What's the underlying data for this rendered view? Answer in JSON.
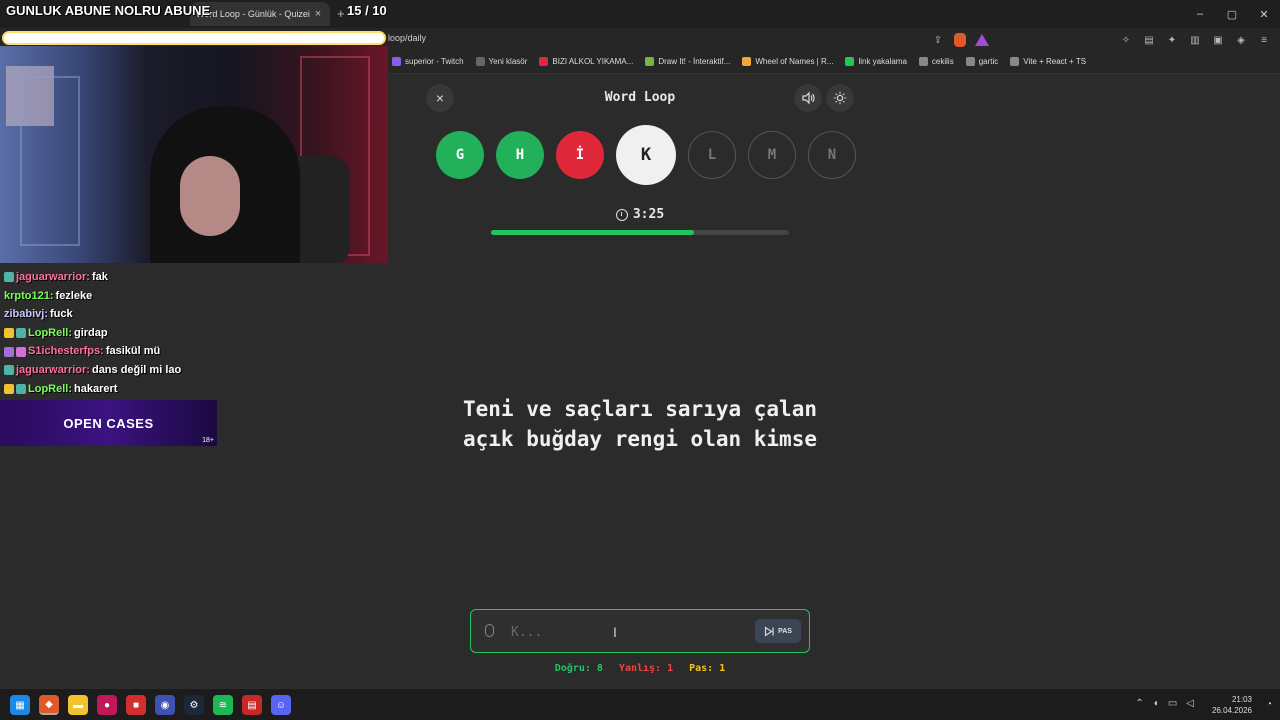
{
  "browser": {
    "tab_title": "Word Loop - Günlük - Quizei",
    "tab_close": "×",
    "new_tab": "+",
    "url": "loop/daily",
    "window_controls": [
      "–",
      "▢",
      "✕"
    ],
    "bookmarks": [
      {
        "label": "superior - Twitch",
        "color": "#8f5ae8"
      },
      {
        "label": "Yeni klasör",
        "color": "#666666"
      },
      {
        "label": "BIZI ALKOL YIKAMA...",
        "color": "#e0283b"
      },
      {
        "label": "Draw It! - İnteraktif...",
        "color": "#7cb342"
      },
      {
        "label": "Wheel of Names | R...",
        "color": "#f2a93b"
      },
      {
        "label": "link yakalama",
        "color": "#22c55e"
      },
      {
        "label": "cekilis",
        "color": "#888888"
      },
      {
        "label": "gartic",
        "color": "#888888"
      },
      {
        "label": "Vite + React + TS",
        "color": "#888888"
      }
    ]
  },
  "overlay": {
    "title": "GUNLUK ABUNE NOLRU ABUNE",
    "count": "15 / 10",
    "chat": [
      {
        "user": "jaguarwarrior:",
        "msg": "fak"
      },
      {
        "user": "krpto121:",
        "msg": "fezleke"
      },
      {
        "user": "zibabivj:",
        "msg": "fuck"
      },
      {
        "user": "LopRell:",
        "msg": "girdap"
      },
      {
        "user": "S1ichesterfps:",
        "msg": "fasikül mü"
      },
      {
        "user": "jaguarwarrior:",
        "msg": "dans değil mi lao"
      },
      {
        "user": "LopRell:",
        "msg": "hakarert"
      }
    ],
    "promo_title": "OPEN CASES",
    "promo_age": "18+"
  },
  "game": {
    "title": "Word Loop",
    "close_icon": "×",
    "letters": [
      {
        "char": "G",
        "state": "correct"
      },
      {
        "char": "H",
        "state": "correct"
      },
      {
        "char": "İ",
        "state": "wrong"
      },
      {
        "char": "K",
        "state": "active"
      },
      {
        "char": "L",
        "state": "pending"
      },
      {
        "char": "M",
        "state": "pending"
      },
      {
        "char": "N",
        "state": "pending"
      }
    ],
    "timer": "3:25",
    "time_remaining_fraction": 0.68,
    "question_line1": "Teni ve saçları sarıya çalan",
    "question_line2": "açık buğday rengi olan kimse",
    "input_placeholder": "K...",
    "pass_label": "PAS",
    "stats": {
      "correct": "Doğru: 8",
      "wrong": "Yanlış: 1",
      "pass": "Pas: 1"
    }
  },
  "taskbar": {
    "time": "21:03",
    "date": "26.04.2026"
  },
  "colors": {
    "correct": "#22b15a",
    "wrong": "#e0283b",
    "accent": "#22c55e"
  }
}
